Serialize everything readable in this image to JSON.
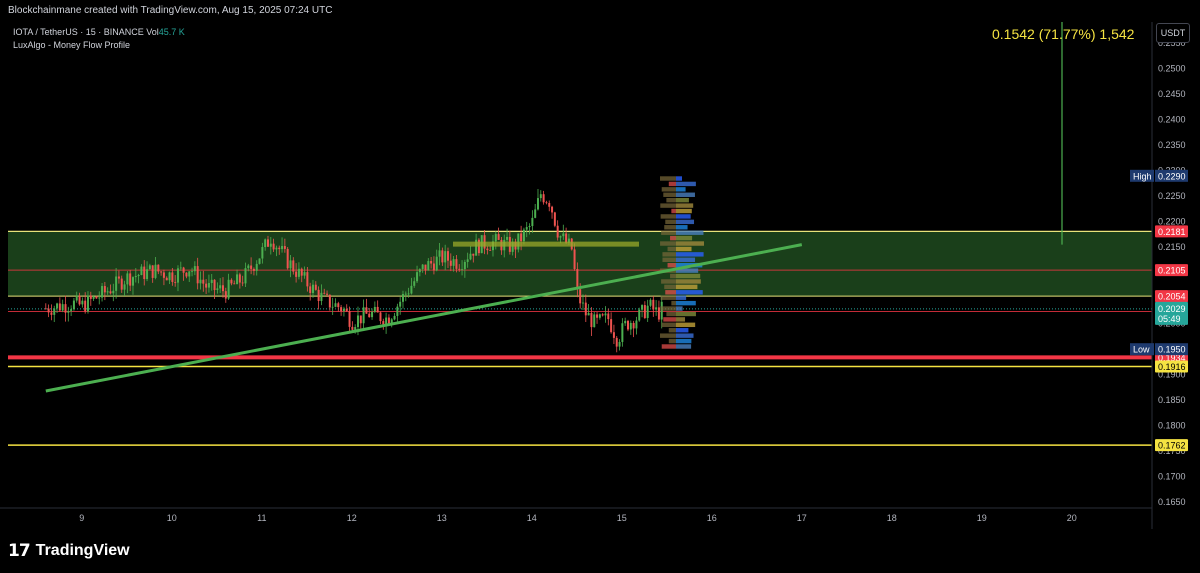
{
  "header": {
    "attribution": "Blockchainmane created with TradingView.com, Aug 15, 2025 07:24 UTC"
  },
  "legend": {
    "symbol_line": "IOTA / TetherUS · 15 · BINANCE",
    "vol_label": "Vol",
    "vol_value": "45.7 K",
    "indicator": "LuxAlgo - Money Flow Profile"
  },
  "measure_label": "0.1542 (71.77%) 1,542",
  "currency_button": "USDT",
  "branding": {
    "logo_mark": "17",
    "logo_text": "TradingView"
  },
  "colors": {
    "background": "#000000",
    "zone_fill": "#1e4a1e",
    "zone_border": "#e8e37a",
    "trendline": "#4caf50",
    "support_red": "#f23645",
    "level_yellow": "#f5e342",
    "up_candle": "#4caf50",
    "down_candle": "#ef5350",
    "measure": "#4caf50"
  },
  "chart_data": {
    "type": "candlestick",
    "x_tick_labels": [
      "9",
      "10",
      "11",
      "12",
      "13",
      "14",
      "15",
      "16",
      "17",
      "18",
      "19",
      "20"
    ],
    "y_tick_labels": [
      "0.2550",
      "0.2500",
      "0.2450",
      "0.2400",
      "0.2350",
      "0.2300",
      "0.2250",
      "0.2200",
      "0.2150",
      "0.2100",
      "0.2050",
      "0.2000",
      "0.1950",
      "0.1900",
      "0.1850",
      "0.1800",
      "0.1750",
      "0.1700",
      "0.1650"
    ],
    "ylim": [
      0.1635,
      0.2565
    ],
    "horizontal_levels": [
      {
        "label": "0.2181",
        "value": 0.2181,
        "style": "zone-top"
      },
      {
        "label": "0.2105",
        "value": 0.2105,
        "style": "red-line"
      },
      {
        "label": "0.2054",
        "value": 0.2054,
        "style": "zone-bottom"
      },
      {
        "label": "0.2024",
        "value": 0.2024,
        "style": "red-line"
      },
      {
        "label": "0.1934",
        "value": 0.1934,
        "style": "red-thick"
      },
      {
        "label": "0.1916",
        "value": 0.1916,
        "style": "yellow"
      },
      {
        "label": "0.1762",
        "value": 0.1762,
        "style": "yellow"
      }
    ],
    "current_price": {
      "value": 0.2029,
      "label": "0.2029",
      "countdown": "05:49"
    },
    "high": {
      "label": "High",
      "value": 0.229,
      "value_label": "0.2290"
    },
    "low": {
      "label": "Low",
      "value": 0.195,
      "value_label": "0.1950"
    },
    "trendline": {
      "start": {
        "x": 8.6,
        "y": 0.1868
      },
      "end": {
        "x": 17.0,
        "y": 0.2155
      }
    },
    "price_path": [
      {
        "x": 8.6,
        "y": 0.203
      },
      {
        "x": 8.9,
        "y": 0.204
      },
      {
        "x": 9.0,
        "y": 0.2035
      },
      {
        "x": 9.2,
        "y": 0.2055
      },
      {
        "x": 9.5,
        "y": 0.209
      },
      {
        "x": 9.8,
        "y": 0.2105
      },
      {
        "x": 10.0,
        "y": 0.2095
      },
      {
        "x": 10.2,
        "y": 0.211
      },
      {
        "x": 10.4,
        "y": 0.207
      },
      {
        "x": 10.6,
        "y": 0.2065
      },
      {
        "x": 10.8,
        "y": 0.209
      },
      {
        "x": 11.0,
        "y": 0.214
      },
      {
        "x": 11.1,
        "y": 0.217
      },
      {
        "x": 11.3,
        "y": 0.212
      },
      {
        "x": 11.5,
        "y": 0.208
      },
      {
        "x": 11.7,
        "y": 0.2045
      },
      {
        "x": 11.9,
        "y": 0.203
      },
      {
        "x": 12.0,
        "y": 0.2005
      },
      {
        "x": 12.2,
        "y": 0.202
      },
      {
        "x": 12.4,
        "y": 0.201
      },
      {
        "x": 12.6,
        "y": 0.206
      },
      {
        "x": 12.8,
        "y": 0.211
      },
      {
        "x": 13.0,
        "y": 0.213
      },
      {
        "x": 13.2,
        "y": 0.212
      },
      {
        "x": 13.4,
        "y": 0.2155
      },
      {
        "x": 13.6,
        "y": 0.216
      },
      {
        "x": 13.8,
        "y": 0.215
      },
      {
        "x": 14.0,
        "y": 0.2195
      },
      {
        "x": 14.1,
        "y": 0.2255
      },
      {
        "x": 14.2,
        "y": 0.224
      },
      {
        "x": 14.3,
        "y": 0.2175
      },
      {
        "x": 14.45,
        "y": 0.2145
      },
      {
        "x": 14.5,
        "y": 0.206
      },
      {
        "x": 14.6,
        "y": 0.202
      },
      {
        "x": 14.7,
        "y": 0.2
      },
      {
        "x": 14.85,
        "y": 0.201
      },
      {
        "x": 14.95,
        "y": 0.197
      },
      {
        "x": 15.05,
        "y": 0.2
      },
      {
        "x": 15.2,
        "y": 0.2015
      },
      {
        "x": 15.3,
        "y": 0.2035
      },
      {
        "x": 15.4,
        "y": 0.202
      },
      {
        "x": 15.45,
        "y": 0.2029
      }
    ],
    "profile_rows_count": 32
  }
}
